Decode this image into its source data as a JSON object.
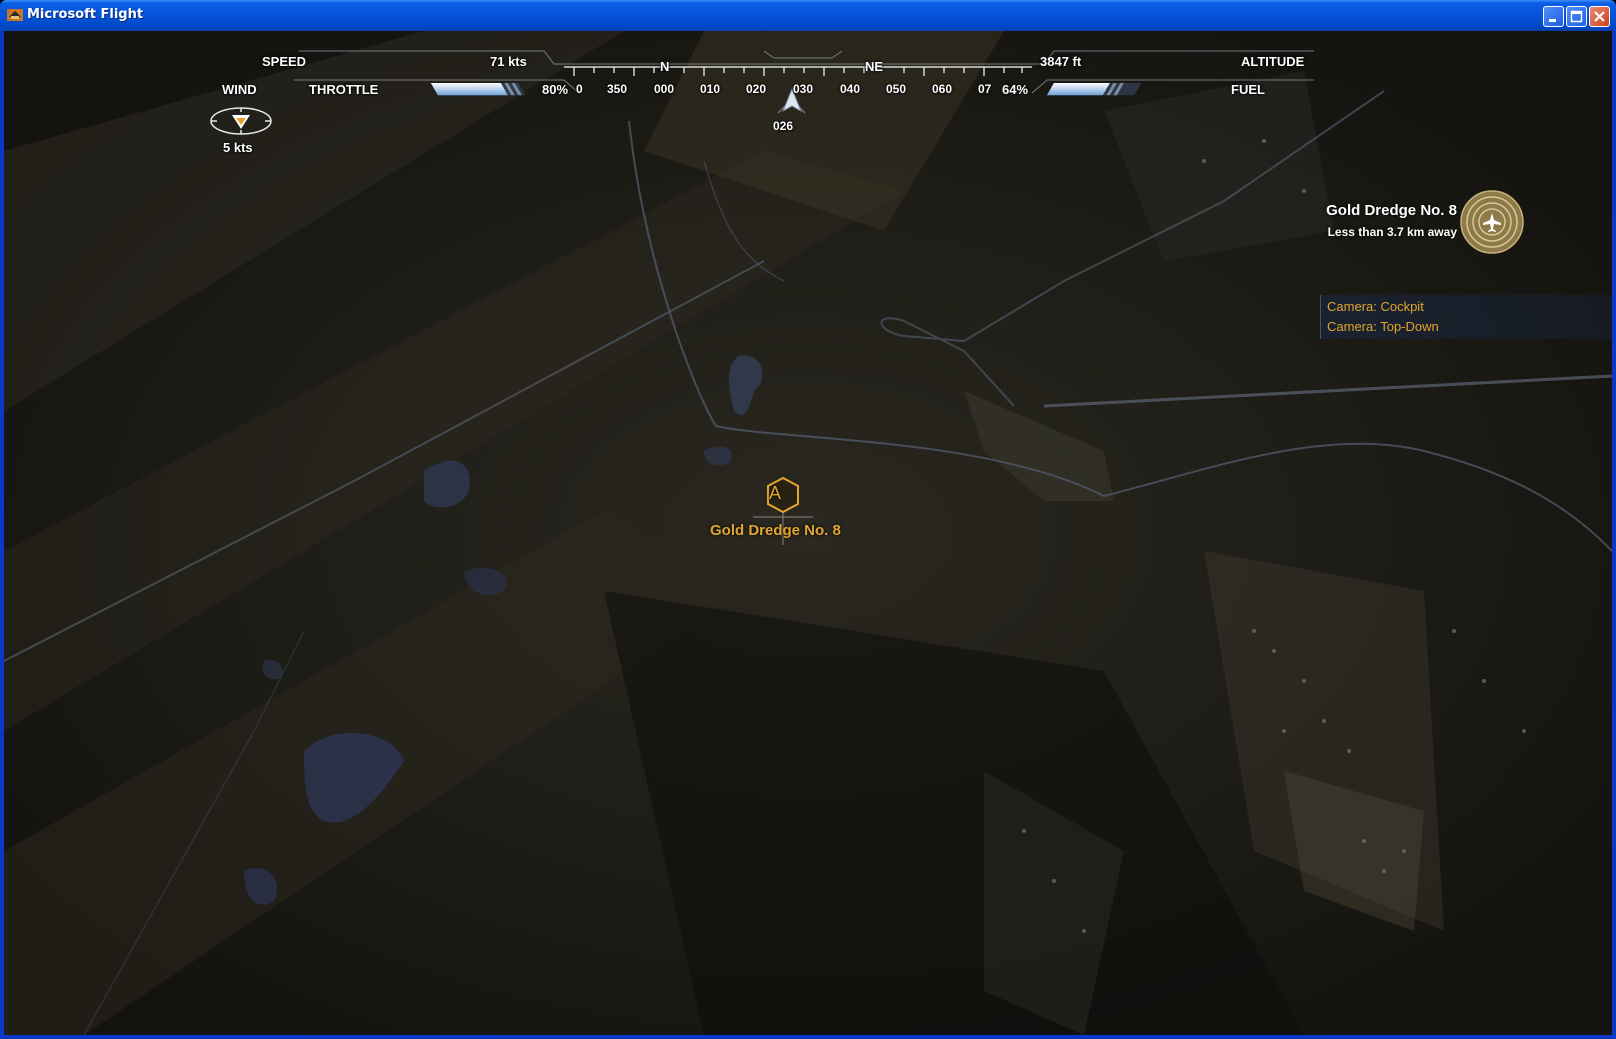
{
  "window": {
    "title": "Microsoft Flight",
    "buttons": {
      "minimize": "minimize",
      "maximize": "maximize",
      "close": "close"
    }
  },
  "hud": {
    "speed_label": "SPEED",
    "speed_value": "71 kts",
    "altitude_label": "ALTITUDE",
    "altitude_value": "3847 ft",
    "wind_label": "WIND",
    "wind_value": "5  kts",
    "throttle_label": "THROTTLE",
    "throttle_value": "80%",
    "throttle_level": 0.8,
    "fuel_label": "FUEL",
    "fuel_value": "64%",
    "fuel_level": 0.64,
    "heading_value": "026",
    "compass": {
      "cardinals": [
        "N",
        "NE"
      ],
      "ticks": [
        "0",
        "350",
        "000",
        "010",
        "020",
        "030",
        "040",
        "050",
        "060",
        "07"
      ]
    }
  },
  "waypoint": {
    "name": "Gold Dredge No. 8",
    "distance": "Less than 3.7 km away",
    "marker_letter": "A",
    "marker_label": "Gold Dredge No. 8"
  },
  "camera_menu": {
    "items": [
      "Camera: Cockpit",
      "Camera: Top-Down"
    ]
  },
  "colors": {
    "accent": "#e3a52d",
    "hud_text": "#ffffff",
    "title_bar": "#0453d9"
  }
}
